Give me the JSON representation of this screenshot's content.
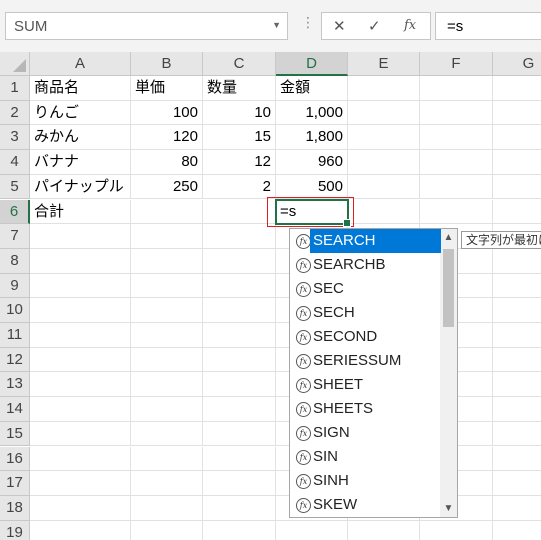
{
  "name_box": {
    "value": "SUM"
  },
  "formula_bar": {
    "cancel_icon": "close-icon",
    "enter_icon": "check-icon",
    "fx_label": "fx",
    "value": "=s"
  },
  "columns": [
    "A",
    "B",
    "C",
    "D",
    "E",
    "F",
    "G"
  ],
  "rows": [
    "1",
    "2",
    "3",
    "4",
    "5",
    "6",
    "7",
    "8",
    "9",
    "10",
    "11",
    "12",
    "13",
    "14",
    "15",
    "16",
    "17",
    "18",
    "19"
  ],
  "cells": {
    "A1": "商品名",
    "B1": "単価",
    "C1": "数量",
    "D1": "金額",
    "A2": "りんご",
    "B2": "100",
    "C2": "10",
    "D2": "1,000",
    "A3": "みかん",
    "B3": "120",
    "C3": "15",
    "D3": "1,800",
    "A4": "バナナ",
    "B4": "80",
    "C4": "12",
    "D4": "960",
    "A5": "パイナップル",
    "B5": "250",
    "C5": "2",
    "D5": "500",
    "A6": "合計",
    "D6": "=s"
  },
  "autocomplete": {
    "items": [
      "SEARCH",
      "SEARCHB",
      "SEC",
      "SECH",
      "SECOND",
      "SERIESSUM",
      "SHEET",
      "SHEETS",
      "SIGN",
      "SIN",
      "SINH",
      "SKEW"
    ],
    "selected_index": 0,
    "tooltip": "文字列が最初に"
  },
  "colors": {
    "accent": "#217346",
    "selection": "#0078d7",
    "highlight_border": "#e02020"
  }
}
